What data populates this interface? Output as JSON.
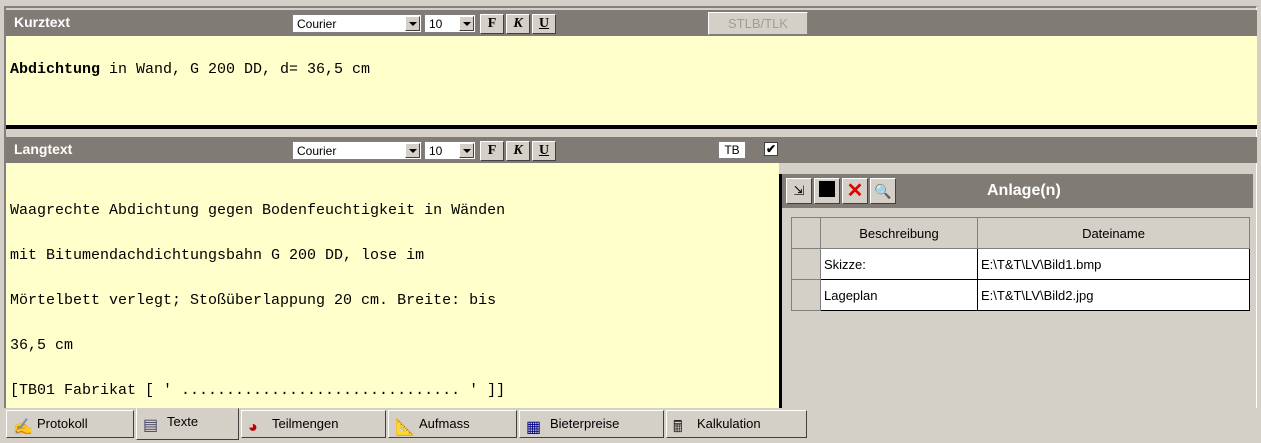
{
  "kurztext": {
    "title": "Kurztext",
    "font": "Courier",
    "size": "10",
    "bold_label": "F",
    "italic_label": "K",
    "underline_label": "U",
    "stlb_label": "STLB/TLK",
    "text_bold": "Abdichtung",
    "text_rest": " in Wand, G 200 DD, d= 36,5 cm"
  },
  "langtext": {
    "title": "Langtext",
    "font": "Courier",
    "size": "10",
    "bold_label": "F",
    "italic_label": "K",
    "underline_label": "U",
    "tb_label": "TB",
    "tb_checked": "✔",
    "lines": [
      "Waagrechte Abdichtung gegen Bodenfeuchtigkeit in Wänden",
      "mit Bitumendachdichtungsbahn G 200 DD, lose im",
      "Mörtelbett verlegt; Stoßüberlappung 20 cm. Breite: bis",
      "36,5 cm",
      "[TB01 Fabrikat [ ' ............................... ' ]]"
    ]
  },
  "attachments": {
    "title": "Anlage(n)",
    "columns": [
      "Beschreibung",
      "Dateiname"
    ],
    "rows": [
      {
        "beschreibung": "Skizze:",
        "dateiname": "E:\\T&T\\LV\\Bild1.bmp"
      },
      {
        "beschreibung": "Lageplan",
        "dateiname": "E:\\T&T\\LV\\Bild2.jpg"
      }
    ]
  },
  "tabs": [
    {
      "label": "Protokoll",
      "icon": "protocol-icon"
    },
    {
      "label": "Texte",
      "icon": "document-icon",
      "active": true
    },
    {
      "label": "Teilmengen",
      "icon": "pie-chart-icon"
    },
    {
      "label": "Aufmass",
      "icon": "measure-icon"
    },
    {
      "label": "Bieterpreise",
      "icon": "table-icon"
    },
    {
      "label": "Kalkulation",
      "icon": "calculator-icon"
    }
  ]
}
